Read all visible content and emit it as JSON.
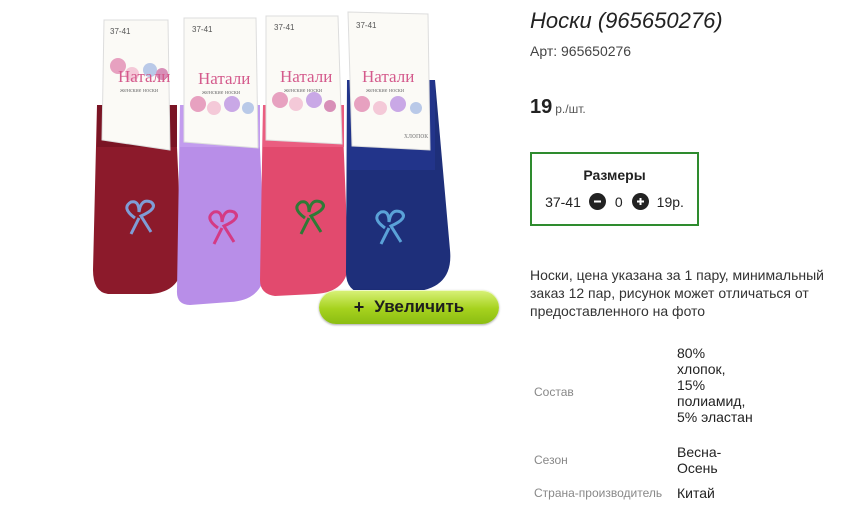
{
  "product": {
    "title": "Носки (965650276)",
    "sku_label": "Арт: 965650276",
    "image": {
      "tag_text": "37-41",
      "brand": "Натали",
      "brand_sub": "женские носки",
      "material_label": "хлопок",
      "sock_colors": [
        "#8c1a2b",
        "#b88ee8",
        "#e24a6e",
        "#1e2f7a"
      ]
    },
    "zoom_button": {
      "icon": "plus-icon",
      "label": "Увеличить"
    }
  },
  "price": {
    "value": "19",
    "unit": "р./шт."
  },
  "sizes": {
    "title": "Размеры",
    "rows": [
      {
        "size": "37-41",
        "quantity": "0",
        "price": "19р."
      }
    ]
  },
  "description": "Носки, цена указана за 1 пару, минимальный заказ 12 пар, рисунок может отличаться от предоставленного на фото",
  "specs": [
    {
      "label": "Состав",
      "value": "80% хлопок, 15% полиамид, 5% эластан"
    },
    {
      "label": "Сезон",
      "value": "Весна-Осень"
    },
    {
      "label": "Страна-производитель",
      "value": "Китай"
    }
  ],
  "colors": {
    "accent_border": "#2e8b2e",
    "button_green": "#a6d21e"
  }
}
